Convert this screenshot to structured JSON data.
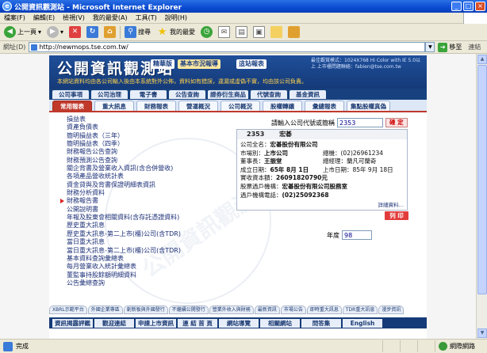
{
  "window": {
    "title": "公開資訊觀測站 - Microsoft Internet Explorer",
    "minimize": "_",
    "maximize": "□",
    "close": "×"
  },
  "menubar": [
    "檔案(F)",
    "編輯(E)",
    "檢視(V)",
    "我的最愛(A)",
    "工具(T)",
    "說明(H)"
  ],
  "toolbar": {
    "back": "上一頁",
    "search": "搜尋",
    "favorites": "我的最愛"
  },
  "addressbar": {
    "label": "網址(D)",
    "url": "http://newmops.tse.com.tw/",
    "go": "移至",
    "links": "連結"
  },
  "site": {
    "title": "公開資訊觀測站",
    "tags": [
      "精華版",
      "基本市況報導",
      "這站報表"
    ],
    "notice": "本網站資料均由各公司輸入後由本系統對外公佈，資料如有錯誤，違漏或虛偽不實，均由該公司負責。",
    "info": "最佳觀賞模式：1024X768 Hi Color with IE 5.0以上  上市櫃問題聯絡：fabien@tse.com.tw",
    "tabs_top": [
      "公司事項",
      "公司治理",
      "電子書",
      "公告查詢",
      "證券衍生商品",
      "代號查詢",
      "基金資訊"
    ],
    "tabs_sub": [
      "常用報表",
      "重大訊息",
      "財務報表",
      "營運概況",
      "公司概況",
      "股權轉讓",
      "彙總報表",
      "集點股權真偽"
    ],
    "active_tab_sub": 0,
    "menu_items": [
      "損益表",
      "資產負債表",
      "簡明損益表（三年）",
      "簡明損益表（四季）",
      "財務報告公告查詢",
      "財務預測公告查詢",
      "關企背書及營業收入資訊(含合併營收)",
      "各項產品營收統計表",
      "資金貸與及背書保證明細表資訊",
      "財務分析資料",
      "財務報告書",
      "公開說明書",
      "年報及股東會相關資料(含存託憑證資料)",
      "歷史重大訊息",
      "歷史重大訊息-第二上市(櫃)公司(含TDR)",
      "當日重大訊息",
      "當日重大訊息-第二上市(櫃)公司(含TDR)",
      "基本資料查詢彙總表",
      "每月營業收入統計彙總表",
      "董監事持股餘額明細資料",
      "公告彙總查詢"
    ],
    "active_menu_index": 10,
    "query": {
      "label": "請輸入公司代號或簡稱",
      "value": "2353",
      "button": "確 定"
    },
    "company": {
      "code": "2353",
      "short_name": "宏碁",
      "rows": [
        {
          "l": "公司全名：",
          "v": "宏碁股份有限公司",
          "r": ""
        },
        {
          "l": "市場別：",
          "v": "上市公司",
          "r": "總機：(02)26961234"
        },
        {
          "l": "董事長：",
          "v": "王振堂",
          "r": "總經理：蘭凡可蘭奇"
        },
        {
          "l": "成立日期：",
          "v": "65年 8月 1日",
          "r": "上市日期：85年 9月 18日"
        },
        {
          "l": "實收資本額：",
          "v": "26091820790元",
          "r": ""
        },
        {
          "l": "股票過戶機構：",
          "v": "宏碁股份有限公司股務室",
          "r": ""
        },
        {
          "l": "過戶機構電話：",
          "v": "(02)25092368",
          "r": ""
        }
      ],
      "detail_link": "詳細資料…"
    },
    "print": "列 印",
    "year": {
      "label": "年度",
      "value": "98"
    },
    "bottom_links": [
      "XBRL示範平台",
      "外國企業專區",
      "創新板與外國發行",
      "不繼續公開發行",
      "營業外收入與財務",
      "最新資訊",
      "市場公告",
      "即時重大訊息",
      "TDR重大訊息",
      "漫步資訊"
    ],
    "footer": [
      "資訊揭露評鑑",
      "觀迎連結",
      "申請上市資訊",
      "連 結 首 頁",
      "網站導覽",
      "相關網站",
      "問答集",
      "English"
    ]
  },
  "statusbar": {
    "text": "完成",
    "zone": "網際網路"
  }
}
